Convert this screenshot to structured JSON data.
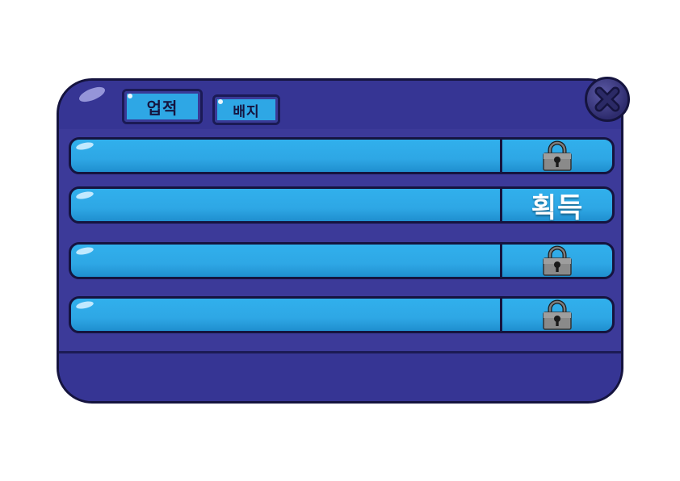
{
  "tabs": [
    {
      "label": "업적",
      "active": true
    },
    {
      "label": "배지",
      "active": false
    }
  ],
  "achievements": [
    {
      "status": "locked",
      "icon": "padlock-icon"
    },
    {
      "status": "claimable",
      "label": "획득"
    },
    {
      "status": "locked",
      "icon": "padlock-icon"
    },
    {
      "status": "locked",
      "icon": "padlock-icon"
    }
  ],
  "close_button": {
    "icon": "close-icon"
  },
  "colors": {
    "panel": "#3c3a99",
    "header": "#363594",
    "row_fill": "#2ea7e5",
    "outline": "#15143f",
    "lock_gray": "#8a8a8a"
  }
}
